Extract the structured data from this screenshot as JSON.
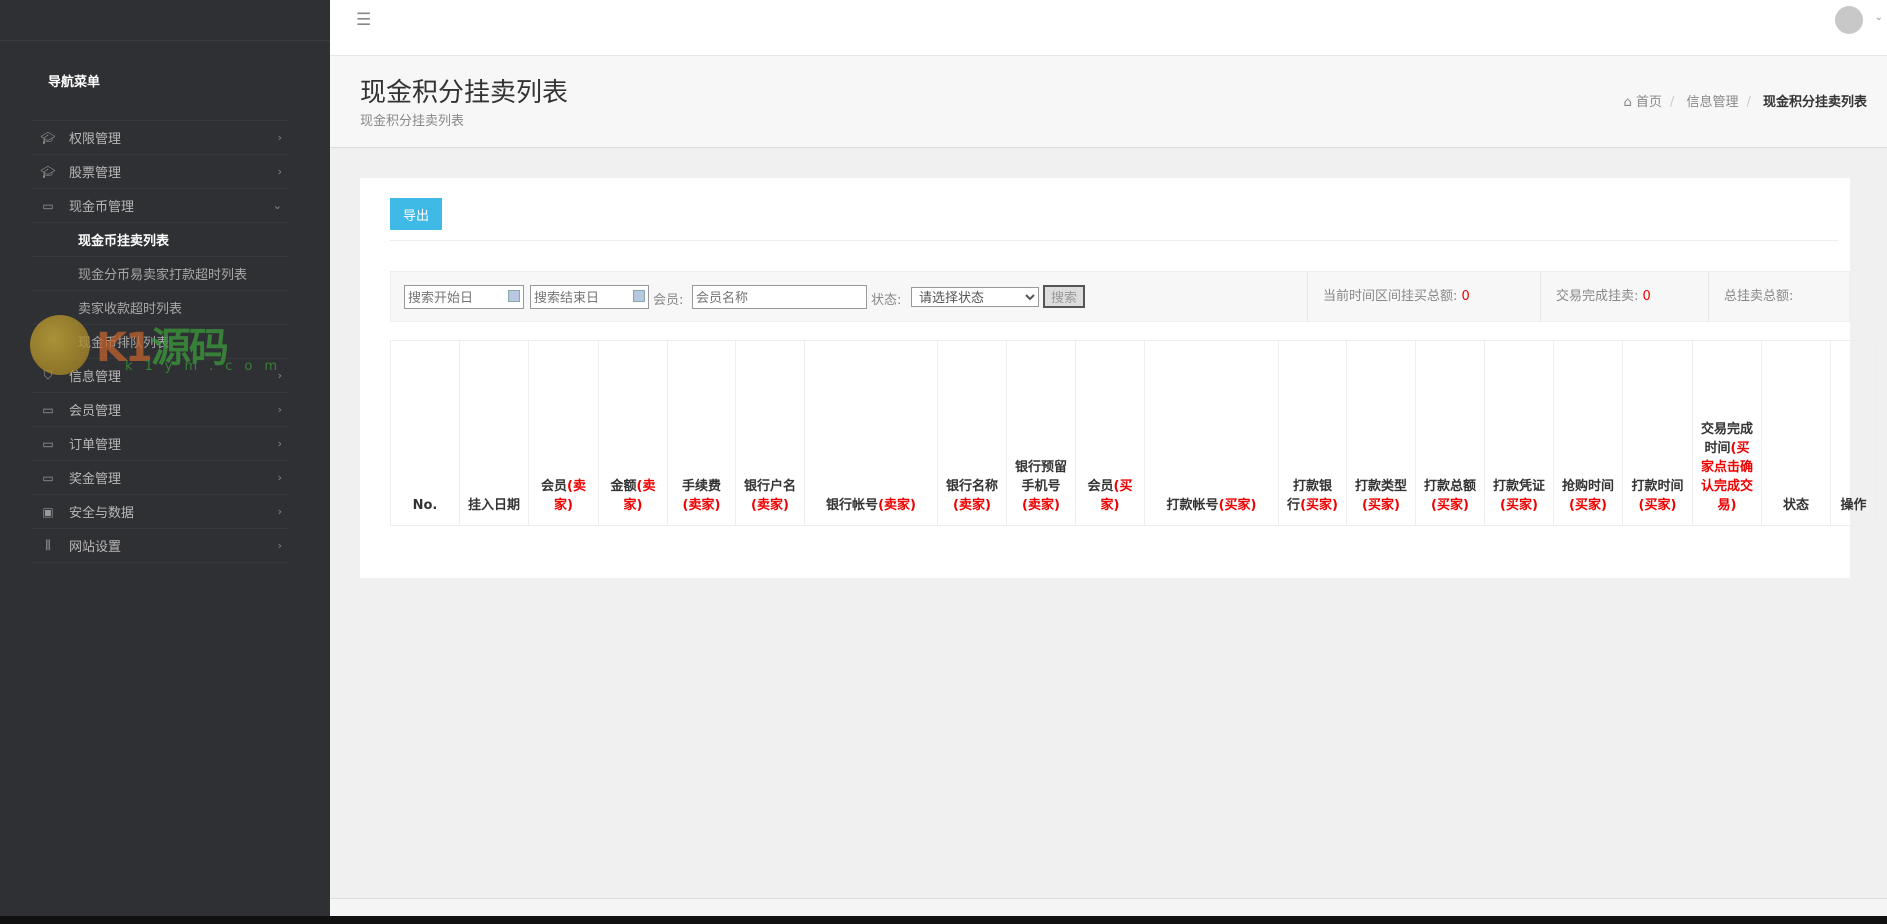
{
  "sidebar": {
    "title": "导航菜单",
    "items": [
      {
        "label": "权限管理",
        "icon": "graduation-cap-icon"
      },
      {
        "label": "股票管理",
        "icon": "graduation-cap-icon"
      },
      {
        "label": "现金币管理",
        "icon": "tag-icon",
        "expanded": true,
        "children": [
          {
            "label": "现金币挂卖列表",
            "active": true
          },
          {
            "label": "现金分币易卖家打款超时列表"
          },
          {
            "label": "卖家收款超时列表"
          },
          {
            "label": "现金币排队列表"
          }
        ]
      },
      {
        "label": "信息管理",
        "icon": "shirt-icon"
      },
      {
        "label": "会员管理",
        "icon": "monitor-icon"
      },
      {
        "label": "订单管理",
        "icon": "monitor-icon"
      },
      {
        "label": "奖金管理",
        "icon": "monitor-icon"
      },
      {
        "label": "安全与数据",
        "icon": "wallet-icon"
      },
      {
        "label": "网站设置",
        "icon": "sliders-icon"
      }
    ]
  },
  "watermark": {
    "text": "K1源码",
    "url": "k1ym.com"
  },
  "page": {
    "title": "现金积分挂卖列表",
    "subtitle": "现金积分挂卖列表"
  },
  "breadcrumb": [
    "首页",
    "信息管理",
    "现金积分挂卖列表"
  ],
  "toolbar": {
    "export_label": "导出"
  },
  "filter": {
    "start_placeholder": "搜索开始日",
    "end_placeholder": "搜索结束日",
    "member_label": "会员:",
    "member_placeholder": "会员名称",
    "status_label": "状态:",
    "status_selected": "请选择状态",
    "search_label": "搜索"
  },
  "stats": [
    {
      "label": "当前时间区间挂买总额:",
      "value": "0"
    },
    {
      "label": "交易完成挂卖:",
      "value": "0"
    },
    {
      "label": "总挂卖总额:",
      "value": ""
    }
  ],
  "table": {
    "columns": [
      {
        "label": "No.",
        "note": ""
      },
      {
        "label": "挂入日期",
        "note": ""
      },
      {
        "label": "会员",
        "note": "(卖家)"
      },
      {
        "label": "金额",
        "note": "(卖家)"
      },
      {
        "label": "手续费",
        "note": "(卖家)"
      },
      {
        "label": "银行户名",
        "note": "(卖家)"
      },
      {
        "label": "银行帐号",
        "note": "(卖家)"
      },
      {
        "label": "银行名称",
        "note": "(卖家)"
      },
      {
        "label": "银行预留手机号",
        "note": "(卖家)"
      },
      {
        "label": "会员",
        "note": "(买家)"
      },
      {
        "label": "打款帐号",
        "note": "(买家)"
      },
      {
        "label": "打款银行",
        "note": "(买家)"
      },
      {
        "label": "打款类型",
        "note": "(买家)"
      },
      {
        "label": "打款总额",
        "note": "(买家)"
      },
      {
        "label": "打款凭证",
        "note": "(买家)"
      },
      {
        "label": "抢购时间",
        "note": "(买家)"
      },
      {
        "label": "打款时间",
        "note": "(买家)"
      },
      {
        "label": "交易完成时间",
        "note": "(买家点击确认完成交易)"
      },
      {
        "label": "状态",
        "note": ""
      },
      {
        "label": "操作",
        "note": ""
      }
    ],
    "rows": []
  },
  "colors": {
    "sidebar": "#2f3033",
    "accent": "#3fbae6",
    "highlight": "#ee0000"
  }
}
